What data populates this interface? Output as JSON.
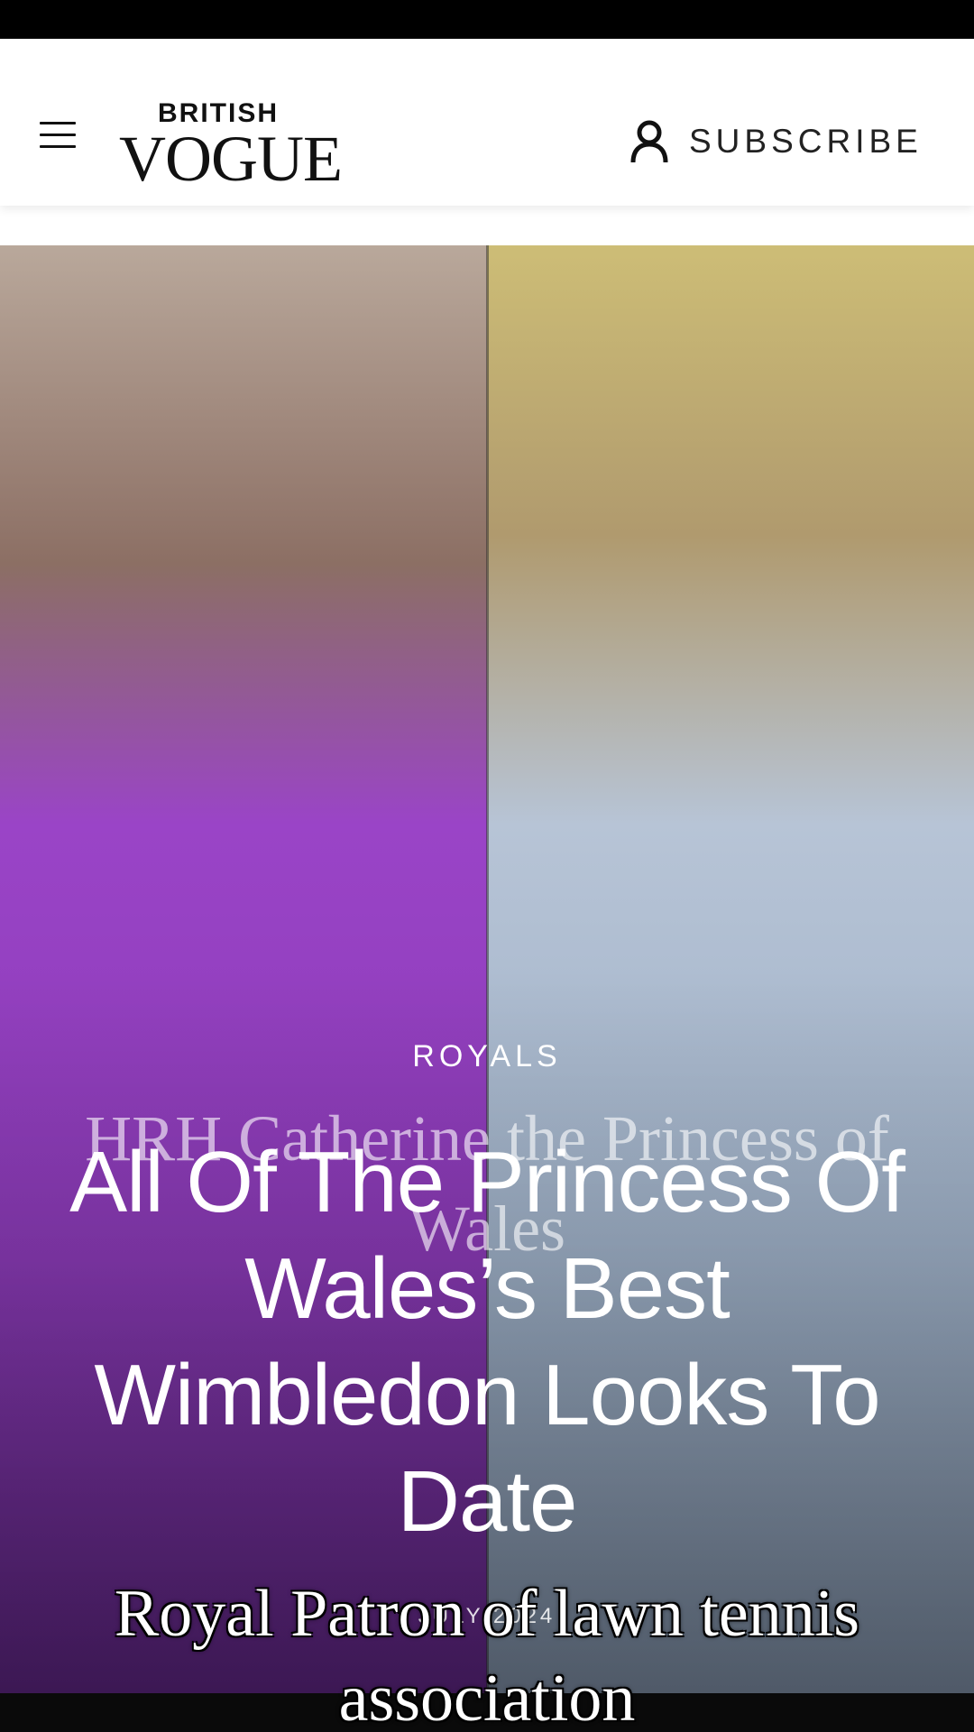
{
  "header": {
    "logo_small": "BRITISH",
    "logo_large": "VOGUE",
    "subscribe_label": "SUBSCRIBE",
    "icons": {
      "menu": "hamburger-menu-icon",
      "account": "user-icon"
    }
  },
  "hero": {
    "category": "ROYALS",
    "headline": "All Of The Princess Of Wales’s Best Wimbledon Looks To Date",
    "date": "JULY 2024",
    "caption_top": "HRH Catherine the Princess of Wales",
    "caption_bottom": "Royal Patron of lawn tennis association"
  },
  "colors": {
    "status_bar": "#000000",
    "header_bg": "#ffffff",
    "text_dark": "#111111",
    "overlay_text": "#ffffff"
  }
}
